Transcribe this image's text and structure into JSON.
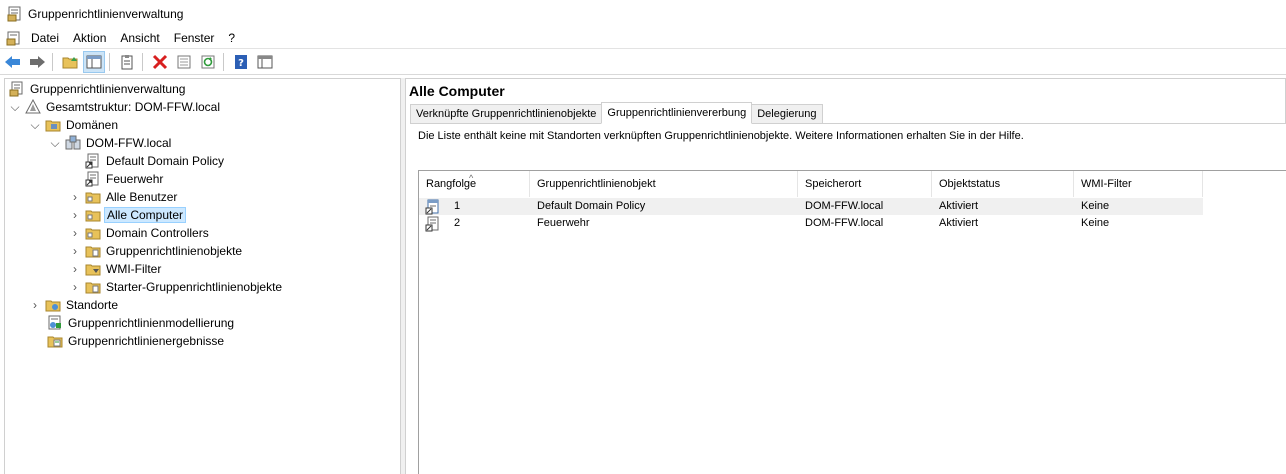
{
  "window": {
    "title": "Gruppenrichtlinienverwaltung"
  },
  "menu": {
    "items": [
      "Datei",
      "Aktion",
      "Ansicht",
      "Fenster",
      "?"
    ]
  },
  "toolbar": {
    "buttons": [
      "back-icon",
      "forward-icon",
      "up-folder-icon",
      "show-tree-icon",
      "clipboard-icon",
      "delete-icon",
      "properties-icon",
      "refresh-icon",
      "help-icon",
      "console-icon"
    ]
  },
  "tree": {
    "root": "Gruppenrichtlinienverwaltung",
    "forest": "Gesamtstruktur: DOM-FFW.local",
    "domains": "Domänen",
    "domain": "DOM-FFW.local",
    "items": {
      "default_policy": "Default Domain Policy",
      "feuerwehr": "Feuerwehr",
      "alle_benutzer": "Alle Benutzer",
      "alle_computer": "Alle Computer",
      "domain_controllers": "Domain Controllers",
      "gpo": "Gruppenrichtlinienobjekte",
      "wmi": "WMI-Filter",
      "starter": "Starter-Gruppenrichtlinienobjekte"
    },
    "standorte": "Standorte",
    "modellierung": "Gruppenrichtlinienmodellierung",
    "ergebnisse": "Gruppenrichtlinienergebnisse"
  },
  "content": {
    "heading": "Alle Computer",
    "tabs": [
      "Verknüpfte Gruppenrichtlinienobjekte",
      "Gruppenrichtlinienvererbung",
      "Delegierung"
    ],
    "active_tab": 1,
    "info": "Die Liste enthält keine mit Standorten verknüpften Gruppenrichtlinienobjekte. Weitere Informationen erhalten Sie in der Hilfe.",
    "columns": [
      "Rangfolge",
      "Gruppenrichtlinienobjekt",
      "Speicherort",
      "Objektstatus",
      "WMI-Filter"
    ],
    "rows": [
      {
        "rank": "1",
        "gpo": "Default Domain Policy",
        "location": "DOM-FFW.local",
        "status": "Aktiviert",
        "wmi": "Keine"
      },
      {
        "rank": "2",
        "gpo": "Feuerwehr",
        "location": "DOM-FFW.local",
        "status": "Aktiviert",
        "wmi": "Keine"
      }
    ]
  }
}
